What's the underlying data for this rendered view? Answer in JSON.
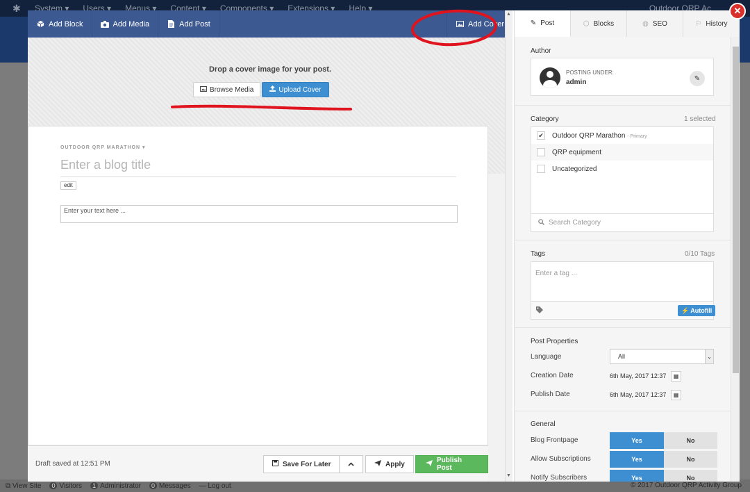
{
  "background": {
    "top_menu": [
      "System ▾",
      "Users ▾",
      "Menus ▾",
      "Content ▾",
      "Components ▾",
      "Extensions ▾",
      "Help ▾"
    ],
    "site_name": "Outdoor QRP Ac",
    "status_bar": {
      "view_site": "View Site",
      "visitors_count": "0",
      "visitors": "Visitors",
      "admin_count": "1",
      "administrator": "Administrator",
      "messages_count": "0",
      "messages": "Messages",
      "logout": "Log out",
      "copyright": "© 2017 Outdoor QRP Activity Group"
    }
  },
  "toolbar": {
    "add_block": "Add Block",
    "add_media": "Add Media",
    "add_post": "Add Post",
    "add_cover": "Add Cover"
  },
  "cover": {
    "drop_text": "Drop a cover image for your post.",
    "browse_media": "Browse Media",
    "upload_cover": "Upload Cover"
  },
  "editor": {
    "category_line": "OUTDOOR QRP MARATHON ▾",
    "title_placeholder": "Enter a blog title",
    "edit_tag": "edit",
    "text_placeholder": "Enter your text here ..."
  },
  "footer": {
    "draft_status": "Draft saved at 12:51 PM",
    "save_for_later": "Save For Later",
    "apply": "Apply",
    "publish": "Publish Post"
  },
  "panel": {
    "tabs": [
      {
        "label": "Post",
        "icon": "pencil-icon",
        "active": true
      },
      {
        "label": "Blocks",
        "icon": "cube-icon",
        "active": false
      },
      {
        "label": "SEO",
        "icon": "globe-icon",
        "active": false
      },
      {
        "label": "History",
        "icon": "flag-icon",
        "active": false
      }
    ],
    "author": {
      "label": "Author",
      "posting_under": "POSTING UNDER:",
      "name": "admin"
    },
    "category": {
      "label": "Category",
      "selected_count": "1 selected",
      "items": [
        {
          "name": "Outdoor QRP Marathon",
          "tag": "- Primary",
          "checked": true
        },
        {
          "name": "QRP equipment",
          "tag": "",
          "checked": false
        },
        {
          "name": "Uncategorized",
          "tag": "",
          "checked": false
        }
      ],
      "search_placeholder": "Search Category"
    },
    "tags": {
      "label": "Tags",
      "count": "0/10 Tags",
      "placeholder": "Enter a tag ...",
      "autofill": "Autofill"
    },
    "properties": {
      "label": "Post Properties",
      "language_label": "Language",
      "language_value": "All",
      "creation_label": "Creation Date",
      "creation_value": "6th May, 2017 12:37",
      "publish_label": "Publish Date",
      "publish_value": "6th May, 2017 12:37"
    },
    "general": {
      "label": "General",
      "rows": [
        {
          "label": "Blog Frontpage",
          "yes": "Yes",
          "no": "No"
        },
        {
          "label": "Allow Subscriptions",
          "yes": "Yes",
          "no": "No"
        },
        {
          "label": "Notify Subscribers",
          "yes": "Yes",
          "no": "No"
        }
      ]
    }
  },
  "colors": {
    "toolbar": "#3c5991",
    "primary_blue": "#3d8fd1",
    "publish_green": "#5cb85c",
    "annotation_red": "#e0141e",
    "close_red": "#d9302c"
  }
}
